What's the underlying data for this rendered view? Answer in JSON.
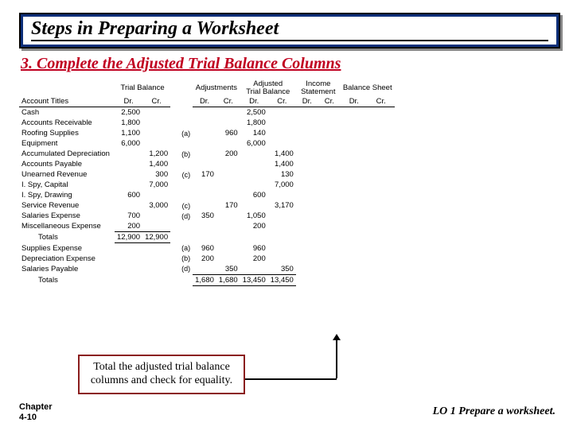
{
  "banner": {
    "title": "Steps in Preparing a Worksheet"
  },
  "subtitle": "3. Complete the Adjusted Trial Balance Columns",
  "columns": {
    "acct": "Account Titles",
    "tb": "Trial Balance",
    "adj": "Adjustments",
    "atb": "Adjusted\nTrial Balance",
    "is": "Income\nStatement",
    "bs": "Balance Sheet",
    "dr": "Dr.",
    "cr": "Cr."
  },
  "rows": [
    {
      "acct": "Cash",
      "tb_dr": "2,500",
      "tb_cr": "",
      "adj_n": "",
      "adj_dr": "",
      "adj_cr": "",
      "atb_dr": "2,500",
      "atb_cr": ""
    },
    {
      "acct": "Accounts Receivable",
      "tb_dr": "1,800",
      "tb_cr": "",
      "adj_n": "",
      "adj_dr": "",
      "adj_cr": "",
      "atb_dr": "1,800",
      "atb_cr": ""
    },
    {
      "acct": "Roofing Supplies",
      "tb_dr": "1,100",
      "tb_cr": "",
      "adj_n": "(a)",
      "adj_dr": "",
      "adj_cr": "960",
      "atb_dr": "140",
      "atb_cr": ""
    },
    {
      "acct": "Equipment",
      "tb_dr": "6,000",
      "tb_cr": "",
      "adj_n": "",
      "adj_dr": "",
      "adj_cr": "",
      "atb_dr": "6,000",
      "atb_cr": ""
    },
    {
      "acct": "Accumulated Depreciation",
      "tb_dr": "",
      "tb_cr": "1,200",
      "adj_n": "(b)",
      "adj_dr": "",
      "adj_cr": "200",
      "atb_dr": "",
      "atb_cr": "1,400"
    },
    {
      "acct": "Accounts Payable",
      "tb_dr": "",
      "tb_cr": "1,400",
      "adj_n": "",
      "adj_dr": "",
      "adj_cr": "",
      "atb_dr": "",
      "atb_cr": "1,400"
    },
    {
      "acct": "Unearned Revenue",
      "tb_dr": "",
      "tb_cr": "300",
      "adj_n": "(c)",
      "adj_dr": "170",
      "adj_cr": "",
      "atb_dr": "",
      "atb_cr": "130"
    },
    {
      "acct": "I. Spy, Capital",
      "tb_dr": "",
      "tb_cr": "7,000",
      "adj_n": "",
      "adj_dr": "",
      "adj_cr": "",
      "atb_dr": "",
      "atb_cr": "7,000"
    },
    {
      "acct": "I. Spy, Drawing",
      "tb_dr": "600",
      "tb_cr": "",
      "adj_n": "",
      "adj_dr": "",
      "adj_cr": "",
      "atb_dr": "600",
      "atb_cr": ""
    },
    {
      "acct": "Service Revenue",
      "tb_dr": "",
      "tb_cr": "3,000",
      "adj_n": "(c)",
      "adj_dr": "",
      "adj_cr": "170",
      "atb_dr": "",
      "atb_cr": "3,170"
    },
    {
      "acct": "Salaries Expense",
      "tb_dr": "700",
      "tb_cr": "",
      "adj_n": "(d)",
      "adj_dr": "350",
      "adj_cr": "",
      "atb_dr": "1,050",
      "atb_cr": ""
    },
    {
      "acct": "Miscellaneous Expense",
      "tb_dr": "200",
      "tb_cr": "",
      "adj_n": "",
      "adj_dr": "",
      "adj_cr": "",
      "atb_dr": "200",
      "atb_cr": ""
    }
  ],
  "totals1": {
    "label": "Totals",
    "tb_dr": "12,900",
    "tb_cr": "12,900"
  },
  "rows2": [
    {
      "acct": "Supplies Expense",
      "adj_n": "(a)",
      "adj_dr": "960",
      "adj_cr": "",
      "atb_dr": "960",
      "atb_cr": ""
    },
    {
      "acct": "Depreciation Expense",
      "adj_n": "(b)",
      "adj_dr": "200",
      "adj_cr": "",
      "atb_dr": "200",
      "atb_cr": ""
    },
    {
      "acct": "Salaries Payable",
      "adj_n": "(d)",
      "adj_dr": "",
      "adj_cr": "350",
      "atb_dr": "",
      "atb_cr": "350"
    }
  ],
  "totals2": {
    "label": "Totals",
    "adj_dr": "1,680",
    "adj_cr": "1,680",
    "atb_dr": "13,450",
    "atb_cr": "13,450"
  },
  "callout": "Total the adjusted trial balance columns and check for equality.",
  "chapter": {
    "line1": "Chapter",
    "line2": "4-10"
  },
  "lo": "LO 1  Prepare a worksheet."
}
